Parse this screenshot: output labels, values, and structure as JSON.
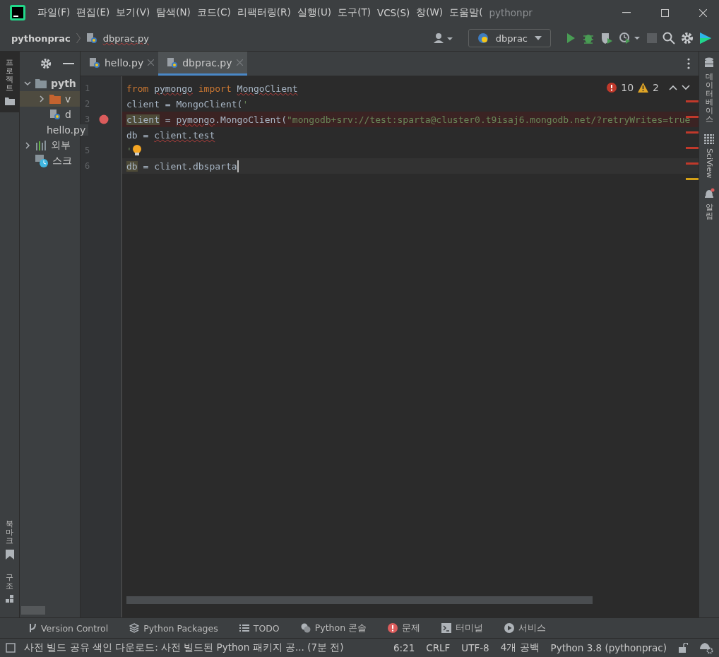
{
  "menu": [
    "파일(F)",
    "편집(E)",
    "보기(V)",
    "탐색(N)",
    "코드(C)",
    "리팩터링(R)",
    "실행(U)",
    "도구(T)",
    "VCS(S)",
    "창(W)",
    "도움말(",
    "pythonpr"
  ],
  "breadcrumb": {
    "project": "pythonprac",
    "file": "dbprac.py"
  },
  "run_config": "dbprac",
  "left_strip": {
    "top": [
      "프로젝트"
    ],
    "bottom": [
      "북마크",
      "구조"
    ]
  },
  "right_strip": [
    "데이터베이스",
    "SciView",
    "알림"
  ],
  "project_tree": [
    {
      "label": "pyth",
      "kind": "folder",
      "expanded": true,
      "children": [
        {
          "label": "v",
          "kind": "venv",
          "expanded": false,
          "selected": true
        },
        {
          "label": "d",
          "kind": "file",
          "selected": false
        },
        {
          "label": "hello.py",
          "kind": "file",
          "selected": false
        }
      ]
    },
    {
      "label": "외부",
      "kind": "library",
      "expanded": false
    },
    {
      "label": "스크",
      "kind": "scratch"
    }
  ],
  "tabs": [
    {
      "label": "hello.py",
      "selected": false
    },
    {
      "label": "dbprac.py",
      "selected": true
    }
  ],
  "inspections": {
    "errors": "10",
    "warnings": "2"
  },
  "code_lines": [
    {
      "number": "1",
      "tokens": [
        {
          "text": "from ",
          "kind": "keyword"
        },
        {
          "text": "pymongo",
          "kind": "error"
        },
        {
          "text": " import ",
          "kind": "keyword"
        },
        {
          "text": "MongoClient",
          "kind": "error"
        }
      ]
    },
    {
      "number": "2",
      "tokens": [
        {
          "text": "client = MongoClient(",
          "kind": "plain"
        },
        {
          "text": "'",
          "kind": "string"
        }
      ]
    },
    {
      "number": "3",
      "breakpoint": true,
      "error": true,
      "tokens": [
        {
          "text": "client",
          "kind": "highlight"
        },
        {
          "text": " = ",
          "kind": "plain"
        },
        {
          "text": "pymongo",
          "kind": "error"
        },
        {
          "text": ".MongoClient(",
          "kind": "plain"
        },
        {
          "text": "\"mongodb+srv://test:sparta@cluster0.t9isaj6.mongodb.net/?retryWrites=true",
          "kind": "string"
        }
      ]
    },
    {
      "tokens": [
        {
          "text": "db = ",
          "kind": "plain"
        },
        {
          "text": "client.test",
          "kind": "error"
        }
      ]
    },
    {
      "number": "5",
      "bulb": true,
      "tokens": [
        {
          "text": "'",
          "kind": "string"
        }
      ]
    },
    {
      "number": "6",
      "current": true,
      "tokens": [
        {
          "text": "db",
          "kind": "highlight"
        },
        {
          "text": " = client.dbsparta",
          "kind": "plain"
        }
      ]
    }
  ],
  "marks": [
    {
      "color": "#c0392b"
    },
    {
      "color": "#c0392b"
    },
    {
      "color": "#c0392b"
    },
    {
      "color": "#c0392b"
    },
    {
      "color": "#c0392b"
    },
    {
      "color": "#d4a017"
    }
  ],
  "tool_windows": [
    {
      "label": "Version Control",
      "kind": "vcs"
    },
    {
      "label": "Python Packages",
      "kind": "layers"
    },
    {
      "label": "TODO",
      "kind": "list"
    },
    {
      "label": "Python 콘솔",
      "kind": "python"
    },
    {
      "label": "문제",
      "kind": "error"
    },
    {
      "label": "터미널",
      "kind": "terminal"
    },
    {
      "label": "서비스",
      "kind": "play"
    }
  ],
  "status": {
    "message": "사전 빌드 공유 색인 다운로드: 사전 빌드된 Python 패키지 공... (7분 전)",
    "position": "6:21",
    "line_ending": "CRLF",
    "encoding": "UTF-8",
    "indent": "4개 공백",
    "interpreter": "Python 3.8 (pythonprac)"
  }
}
